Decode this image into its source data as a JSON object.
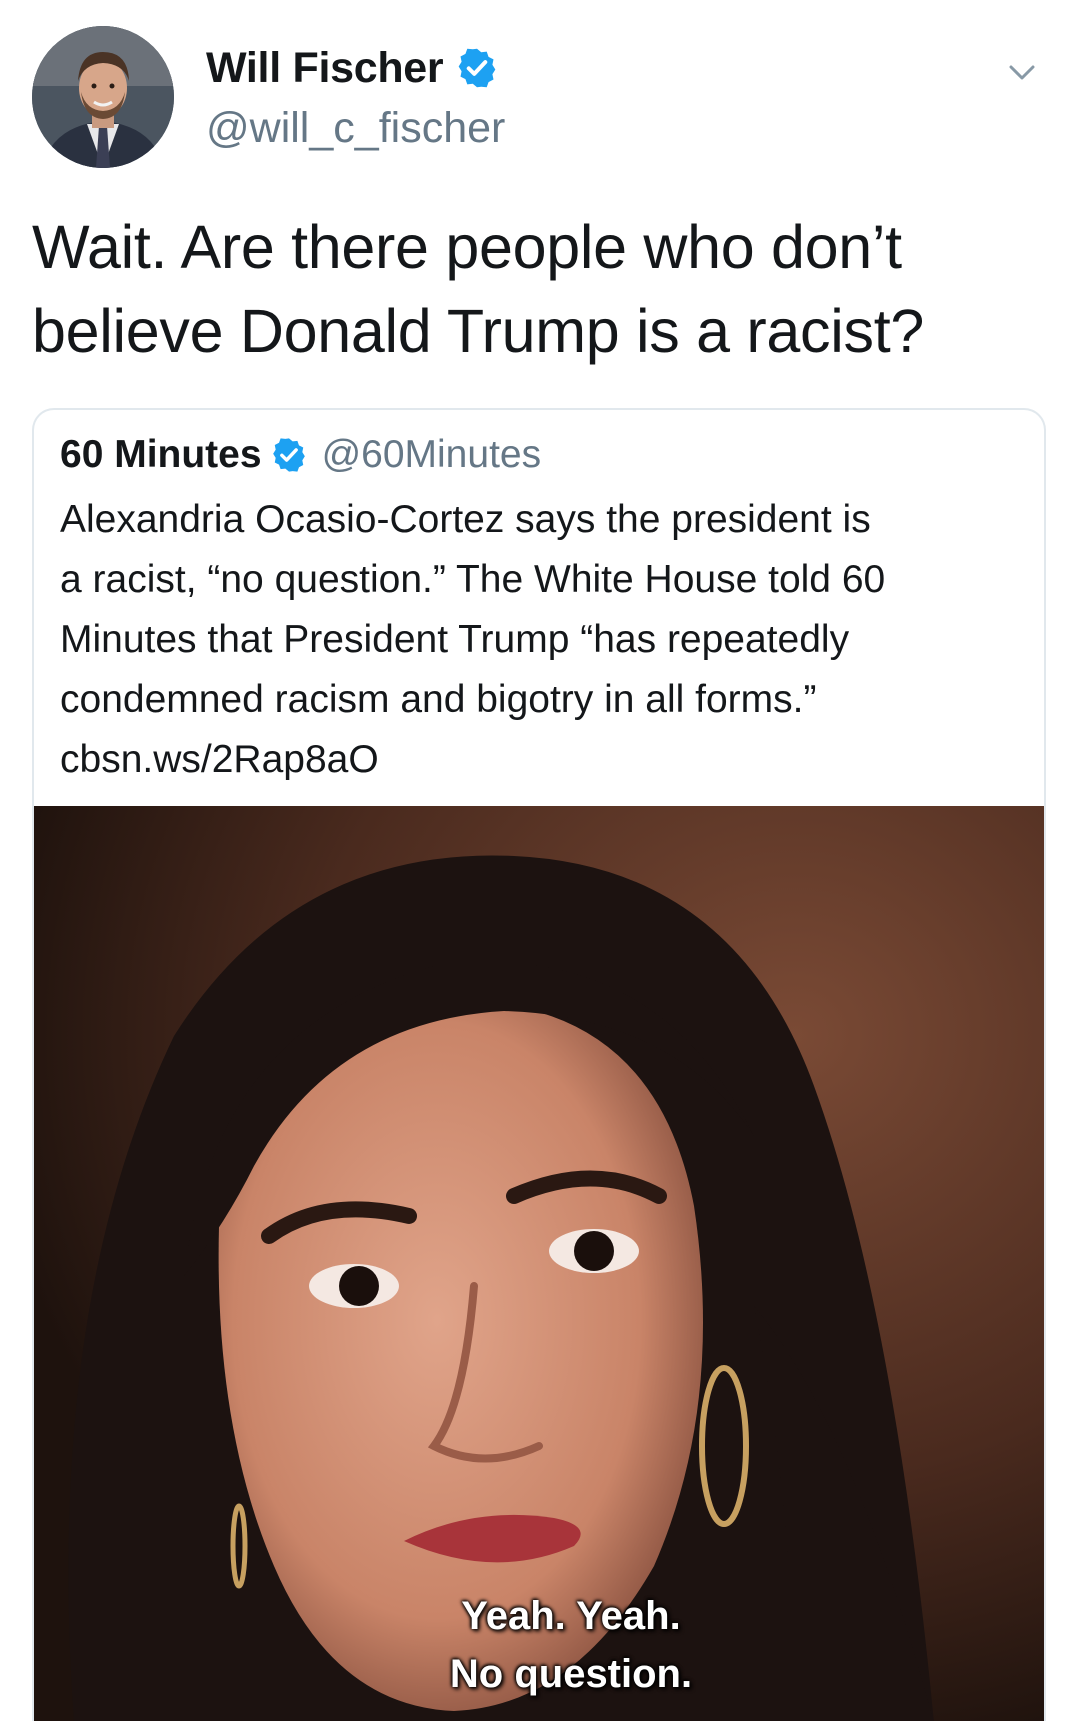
{
  "tweet": {
    "author": {
      "display_name": "Will Fischer",
      "handle": "@will_c_fischer",
      "verified": true
    },
    "text_line1": "Wait. Are there people who don’t",
    "text_line2": "believe Donald Trump is a racist?",
    "menu_icon": "chevron-down-icon"
  },
  "quoted_tweet": {
    "author": {
      "display_name": "60 Minutes",
      "handle": "@60Minutes",
      "verified": true
    },
    "text_lines": [
      "Alexandria Ocasio-Cortez says the president is",
      "a racist, “no question.” The White House told 60",
      "Minutes that President Trump “has repeatedly",
      "condemned racism and bigotry in all forms.”",
      "cbsn.ws/2Rap8aO"
    ],
    "media": {
      "caption_line1": "Yeah. Yeah.",
      "caption_line2": "No question."
    }
  },
  "colors": {
    "text": "#14171a",
    "secondary": "#657786",
    "verified": "#1da1f2",
    "border": "#e1e8ed"
  }
}
